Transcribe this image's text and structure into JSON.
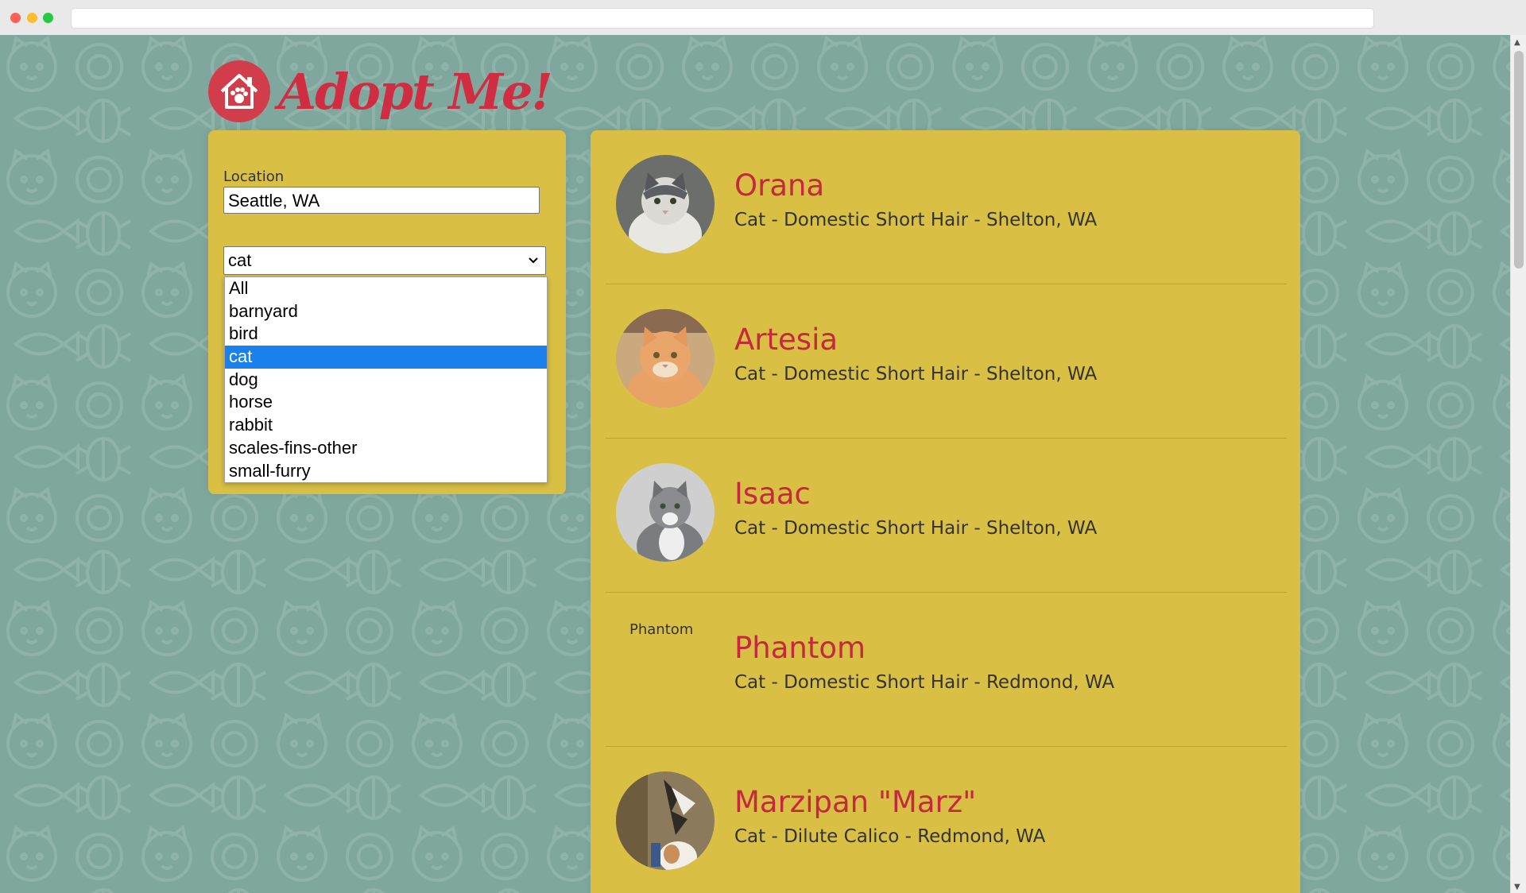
{
  "brand": {
    "title": "Adopt Me!",
    "accent": "#d12d42",
    "panel": "#d9c045",
    "background": "#7fa79d"
  },
  "search": {
    "location_label": "Location",
    "location_value": "Seattle, WA",
    "animal_selected": "cat",
    "animal_options": [
      "All",
      "barnyard",
      "bird",
      "cat",
      "dog",
      "horse",
      "rabbit",
      "scales-fins-other",
      "small-furry"
    ]
  },
  "pets": [
    {
      "name": "Orana",
      "desc": "Cat - Domestic Short Hair - Shelton, WA",
      "image": "cat-photo"
    },
    {
      "name": "Artesia",
      "desc": "Cat - Domestic Short Hair - Shelton, WA",
      "image": "cat-photo"
    },
    {
      "name": "Isaac",
      "desc": "Cat - Domestic Short Hair - Shelton, WA",
      "image": "cat-photo"
    },
    {
      "name": "Phantom",
      "desc": "Cat - Domestic Short Hair - Redmond, WA",
      "image": "broken-image",
      "alt": "Phantom"
    },
    {
      "name": "Marzipan \"Marz\"",
      "desc": "Cat - Dilute Calico - Redmond, WA",
      "image": "cat-photo"
    }
  ]
}
